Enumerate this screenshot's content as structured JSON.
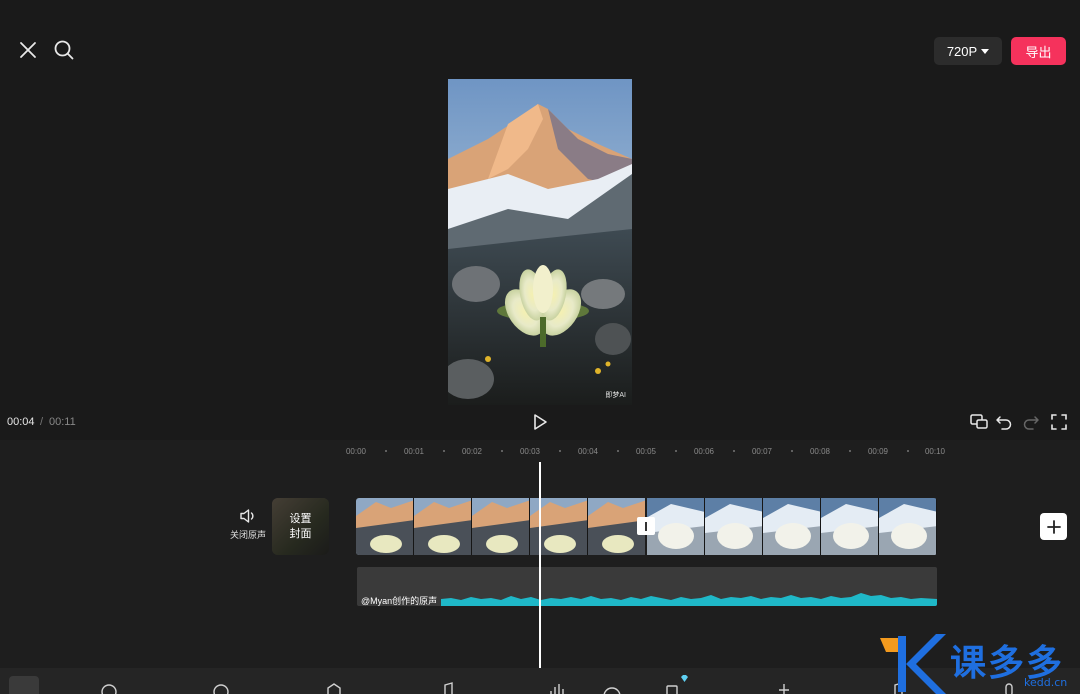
{
  "topbar": {
    "resolution": "720P",
    "export_label": "导出"
  },
  "preview": {
    "watermark": "即梦AI"
  },
  "player": {
    "current_time": "00:04",
    "separator": "/",
    "total_time": "00:11"
  },
  "ruler": {
    "labels": [
      "00:00",
      "00:01",
      "00:02",
      "00:03",
      "00:04",
      "00:05",
      "00:06",
      "00:07",
      "00:08",
      "00:09",
      "00:10"
    ]
  },
  "timeline": {
    "mute_label": "关闭原声",
    "cover_line1": "设置",
    "cover_line2": "封面",
    "audio_label": "@Myan创作的原声"
  },
  "logo": {
    "text": "课多多",
    "url": "kedd.cn"
  },
  "colors": {
    "accent": "#f5325c",
    "waveform": "#1fb8c8",
    "logo": "#1f6fe0",
    "logo_orange": "#f39a1e"
  }
}
